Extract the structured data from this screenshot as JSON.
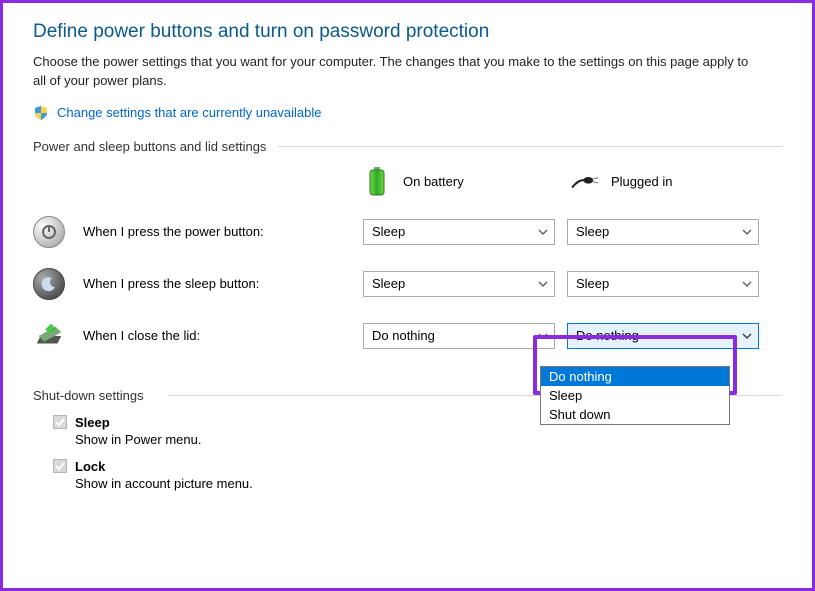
{
  "title": "Define power buttons and turn on password protection",
  "subtitle": "Choose the power settings that you want for your computer. The changes that you make to the settings on this page apply to all of your power plans.",
  "change_link": "Change settings that are currently unavailable",
  "section1_label": "Power and sleep buttons and lid settings",
  "headers": {
    "battery": "On battery",
    "plugged": "Plugged in"
  },
  "rows": {
    "power": {
      "label": "When I press the power button:",
      "battery": "Sleep",
      "plugged": "Sleep"
    },
    "sleep": {
      "label": "When I press the sleep button:",
      "battery": "Sleep",
      "plugged": "Sleep"
    },
    "lid": {
      "label": "When I close the lid:",
      "battery": "Do nothing",
      "plugged": "Do nothing"
    }
  },
  "dropdown_options": [
    "Do nothing",
    "Sleep",
    "Shut down"
  ],
  "section2_label": "Shut-down settings",
  "shutdown": {
    "sleep": {
      "label": "Sleep",
      "desc": "Show in Power menu."
    },
    "lock": {
      "label": "Lock",
      "desc": "Show in account picture menu."
    }
  }
}
